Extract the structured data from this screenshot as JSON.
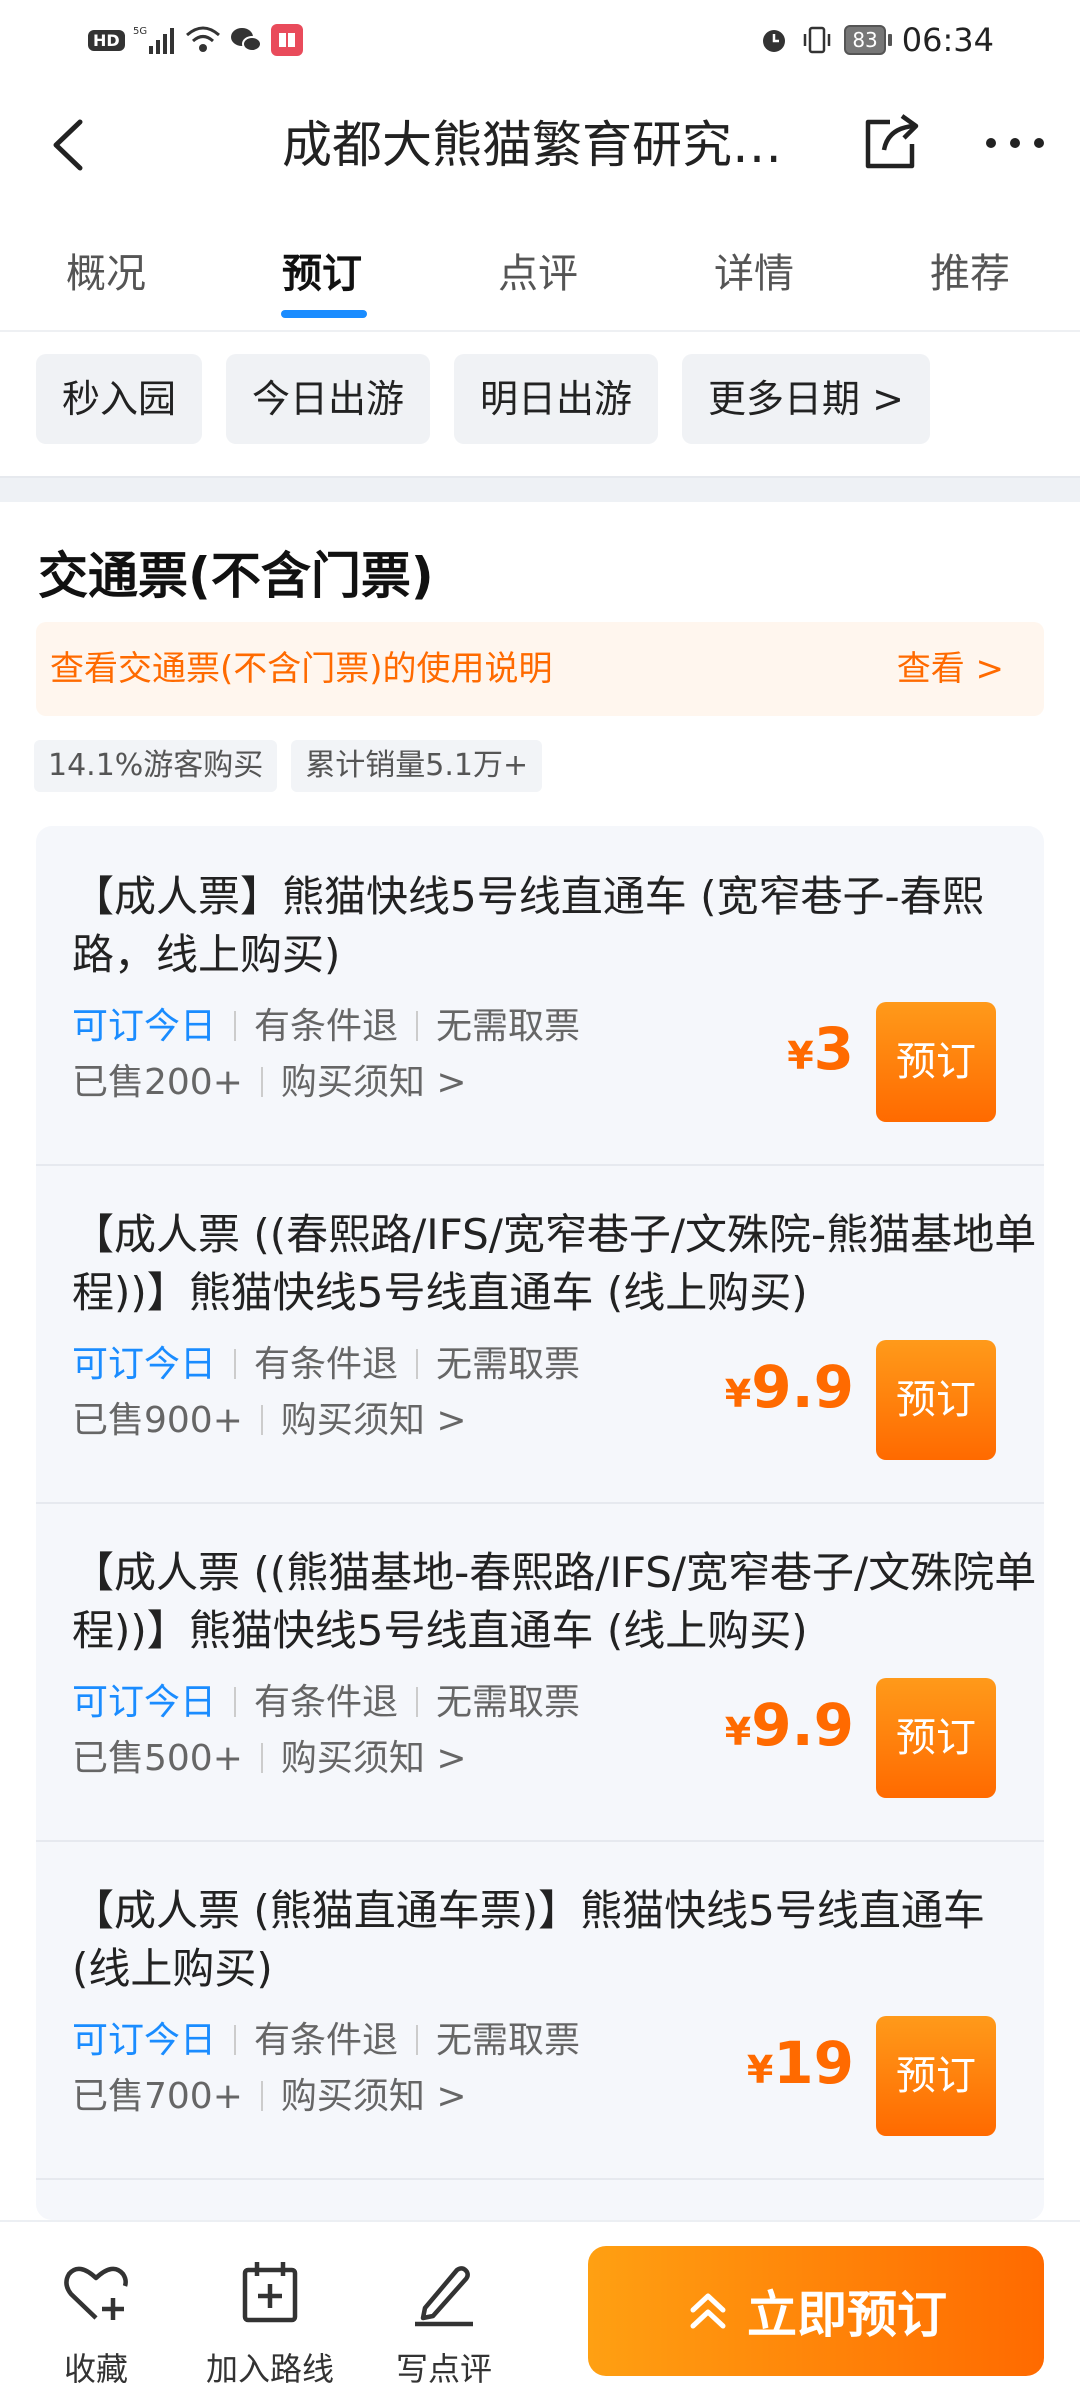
{
  "status_bar": {
    "time": "06:34",
    "battery": "83",
    "signal": "5G",
    "hd": "HD"
  },
  "nav": {
    "title": "成都大熊猫繁育研究…",
    "back_icon": "back-arrow-icon",
    "share_icon": "share-icon",
    "more_icon": "more-icon"
  },
  "tabs": [
    {
      "label": "概况",
      "active": false
    },
    {
      "label": "预订",
      "active": true
    },
    {
      "label": "点评",
      "active": false
    },
    {
      "label": "详情",
      "active": false
    },
    {
      "label": "推荐",
      "active": false
    }
  ],
  "date_chips": [
    "秒入园",
    "今日出游",
    "明日出游",
    "更多日期 >"
  ],
  "section": {
    "title": "交通票(不含门票)",
    "notice_text": "查看交通票(不含门票)的使用说明",
    "notice_link": "查看 >",
    "stats": [
      "14.1%游客购买",
      "累计销量5.1万+"
    ]
  },
  "tickets": [
    {
      "title": "【成人票】熊猫快线5号线直通车 (宽窄巷子-春熙路，线上购买)",
      "tag_available": "可订今日",
      "tag_refund": "有条件退",
      "tag_pickup": "无需取票",
      "sold": "已售200+",
      "notice": "购买须知 >",
      "currency": "¥",
      "price": "3",
      "button": "预订"
    },
    {
      "title": "【成人票 ((春熙路/IFS/宽窄巷子/文殊院-熊猫基地单程))】熊猫快线5号线直通车 (线上购买)",
      "tag_available": "可订今日",
      "tag_refund": "有条件退",
      "tag_pickup": "无需取票",
      "sold": "已售900+",
      "notice": "购买须知 >",
      "currency": "¥",
      "price": "9.9",
      "button": "预订"
    },
    {
      "title": "【成人票 ((熊猫基地-春熙路/IFS/宽窄巷子/文殊院单程))】熊猫快线5号线直通车 (线上购买)",
      "tag_available": "可订今日",
      "tag_refund": "有条件退",
      "tag_pickup": "无需取票",
      "sold": "已售500+",
      "notice": "购买须知 >",
      "currency": "¥",
      "price": "9.9",
      "button": "预订"
    },
    {
      "title": "【成人票 (熊猫直通车票)】熊猫快线5号线直通车 (线上购买)",
      "tag_available": "可订今日",
      "tag_refund": "有条件退",
      "tag_pickup": "无需取票",
      "sold": "已售700+",
      "notice": "购买须知 >",
      "currency": "¥",
      "price": "19",
      "button": "预订"
    }
  ],
  "bottom_bar": {
    "favorite": "收藏",
    "add_route": "加入路线",
    "write_review": "写点评",
    "book_now": "立即预订"
  },
  "colors": {
    "accent_orange": "#ff6a00",
    "accent_blue": "#1a8cff"
  }
}
